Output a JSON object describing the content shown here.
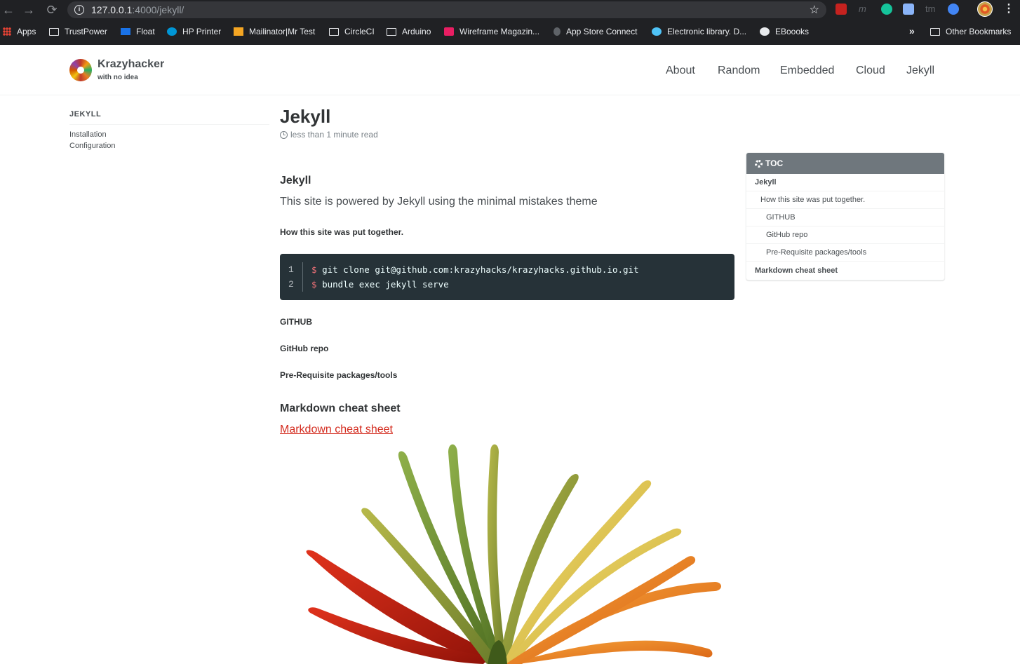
{
  "browser": {
    "url_host": "127.0.0.1",
    "url_path": ":4000/jekyll/",
    "nav": {
      "back": "←",
      "forward": "→",
      "reload": "⟳"
    },
    "extension_text": {
      "m": "m",
      "tm": "tm"
    },
    "bookmarks": [
      {
        "label": "Apps"
      },
      {
        "label": "TrustPower"
      },
      {
        "label": "Float"
      },
      {
        "label": "HP Printer"
      },
      {
        "label": "Mailinator|Mr Test"
      },
      {
        "label": "CircleCI"
      },
      {
        "label": "Arduino"
      },
      {
        "label": "Wireframe Magazin..."
      },
      {
        "label": "App Store Connect"
      },
      {
        "label": "Electronic library. D..."
      },
      {
        "label": "EBoooks"
      }
    ],
    "more_bookmarks": "»",
    "other_bookmarks": "Other Bookmarks"
  },
  "site": {
    "title": "Krazyhacker",
    "subtitle": "with no idea",
    "nav": [
      "About",
      "Random",
      "Embedded",
      "Cloud",
      "Jekyll"
    ]
  },
  "sidebar": {
    "title": "JEKYLL",
    "links": [
      "Installation",
      "Configuration"
    ]
  },
  "page": {
    "title": "Jekyll",
    "read_time": "less than 1 minute read",
    "heading_jekyll": "Jekyll",
    "lead": "This site is powered by Jekyll using the minimal mistakes theme",
    "heading_put_together": "How this site was put together.",
    "code": {
      "line_numbers": [
        "1",
        "2"
      ],
      "prompt": "$",
      "lines": [
        "git clone git@github.com:krazyhacks/krazyhacks.github.io.git",
        "bundle exec jekyll serve"
      ]
    },
    "heading_github": "GITHUB",
    "heading_github_repo": "GitHub repo",
    "heading_prereq": "Pre-Requisite packages/tools",
    "heading_markdown": "Markdown cheat sheet",
    "markdown_link": "Markdown cheat sheet"
  },
  "toc": {
    "title": "TOC",
    "items": [
      {
        "label": "Jekyll"
      },
      {
        "label": "How this site was put together."
      },
      {
        "label": "GITHUB"
      },
      {
        "label": "GitHub repo"
      },
      {
        "label": "Pre-Requisite packages/tools"
      },
      {
        "label": "Markdown cheat sheet"
      }
    ]
  },
  "colors": {
    "chrome_bg": "#202124",
    "text": "#494e52",
    "link": "#d42c1f",
    "code_bg": "#263238",
    "toc_header": "#6f777d"
  }
}
